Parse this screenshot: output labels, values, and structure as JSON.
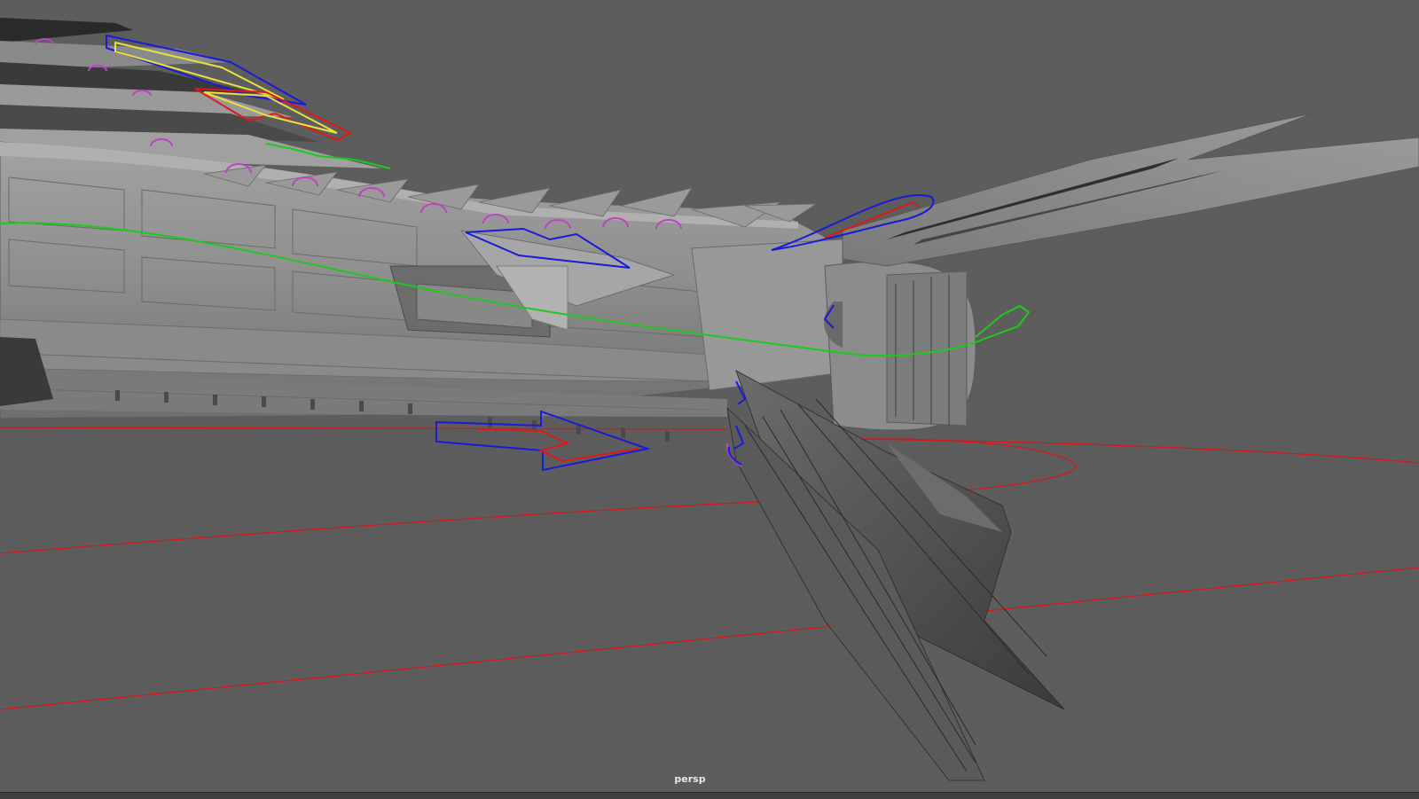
{
  "viewport": {
    "camera_label": "persp",
    "background_color": "#5d5d5d",
    "mesh_color": "#909090",
    "curve_colors": {
      "green": "#1ec81e",
      "blue": "#1a1ad8",
      "red": "#e01818",
      "yellow": "#e8e040",
      "magenta": "#c040c8"
    }
  }
}
